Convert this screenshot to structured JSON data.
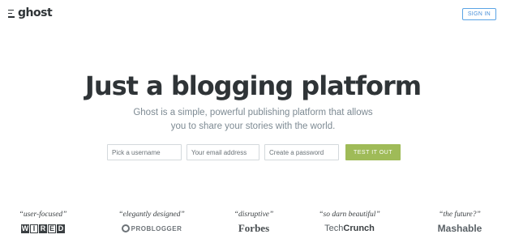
{
  "header": {
    "logo_text": "ghost",
    "signin_label": "SIGN IN"
  },
  "hero": {
    "title": "Just a blogging platform",
    "subtitle": "Ghost is a simple, powerful publishing platform that allows you to share your stories with the world."
  },
  "signup_form": {
    "username_placeholder": "Pick a username",
    "email_placeholder": "Your email address",
    "password_placeholder": "Create a password",
    "submit_label": "TEST IT OUT"
  },
  "press": [
    {
      "quote": "“user-focused”",
      "brand": "WIRED"
    },
    {
      "quote": "“elegantly designed”",
      "brand": "PROBLOGGER"
    },
    {
      "quote": "“disruptive”",
      "brand": "Forbes"
    },
    {
      "quote": "“so darn beautiful”",
      "brand_a": "Tech",
      "brand_b": "Crunch"
    },
    {
      "quote": "“the future?”",
      "brand": "Mashable"
    }
  ],
  "colors": {
    "accent_button": "#9fbb58",
    "signin_border": "#5ba4e5",
    "title_text": "#2f3437"
  }
}
